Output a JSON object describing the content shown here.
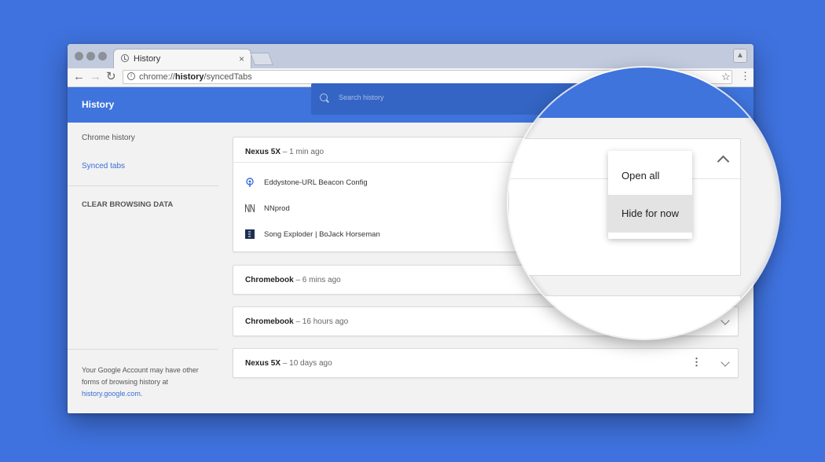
{
  "browser": {
    "tab_title": "History",
    "tab_close": "×",
    "url_prefix": "chrome://",
    "url_bold": "history",
    "url_suffix": "/syncedTabs",
    "info_glyph": "i",
    "back_glyph": "←",
    "forward_glyph": "→",
    "reload_glyph": "↻",
    "star_glyph": "☆",
    "menu_glyph": "⋮"
  },
  "header": {
    "title": "History",
    "search_placeholder": "Search history"
  },
  "sidebar": {
    "items": [
      {
        "label": "Chrome history"
      },
      {
        "label": "Synced tabs"
      },
      {
        "label": "CLEAR BROWSING DATA"
      }
    ],
    "footnote_text": "Your Google Account may have other forms of browsing history at",
    "footnote_link": "history.google.com",
    "footnote_end": "."
  },
  "devices": [
    {
      "name": "Nexus 5X",
      "separator": " – ",
      "time": "1 min ago",
      "tabs": [
        {
          "title": "Eddystone-URL Beacon Config",
          "icon": "beacon-icon"
        },
        {
          "title": "NNprod",
          "icon": "nn-icon"
        },
        {
          "title": "Song Exploder | BoJack Horseman",
          "icon": "song-exploder-icon"
        }
      ]
    },
    {
      "name": "Chromebook",
      "separator": " – ",
      "time": "6 mins ago"
    },
    {
      "name": "Chromebook",
      "separator": " – ",
      "time": "16 hours ago"
    },
    {
      "name": "Nexus 5X",
      "separator": " – ",
      "time": "10 days ago"
    }
  ],
  "card_menu_glyph": "⋮",
  "popup_menu": {
    "items": [
      {
        "label": "Open all"
      },
      {
        "label": "Hide for now"
      }
    ]
  },
  "colors": {
    "background": "#3f72de",
    "header_blue": "#3e74dc",
    "link_blue": "#3b6fd6"
  }
}
